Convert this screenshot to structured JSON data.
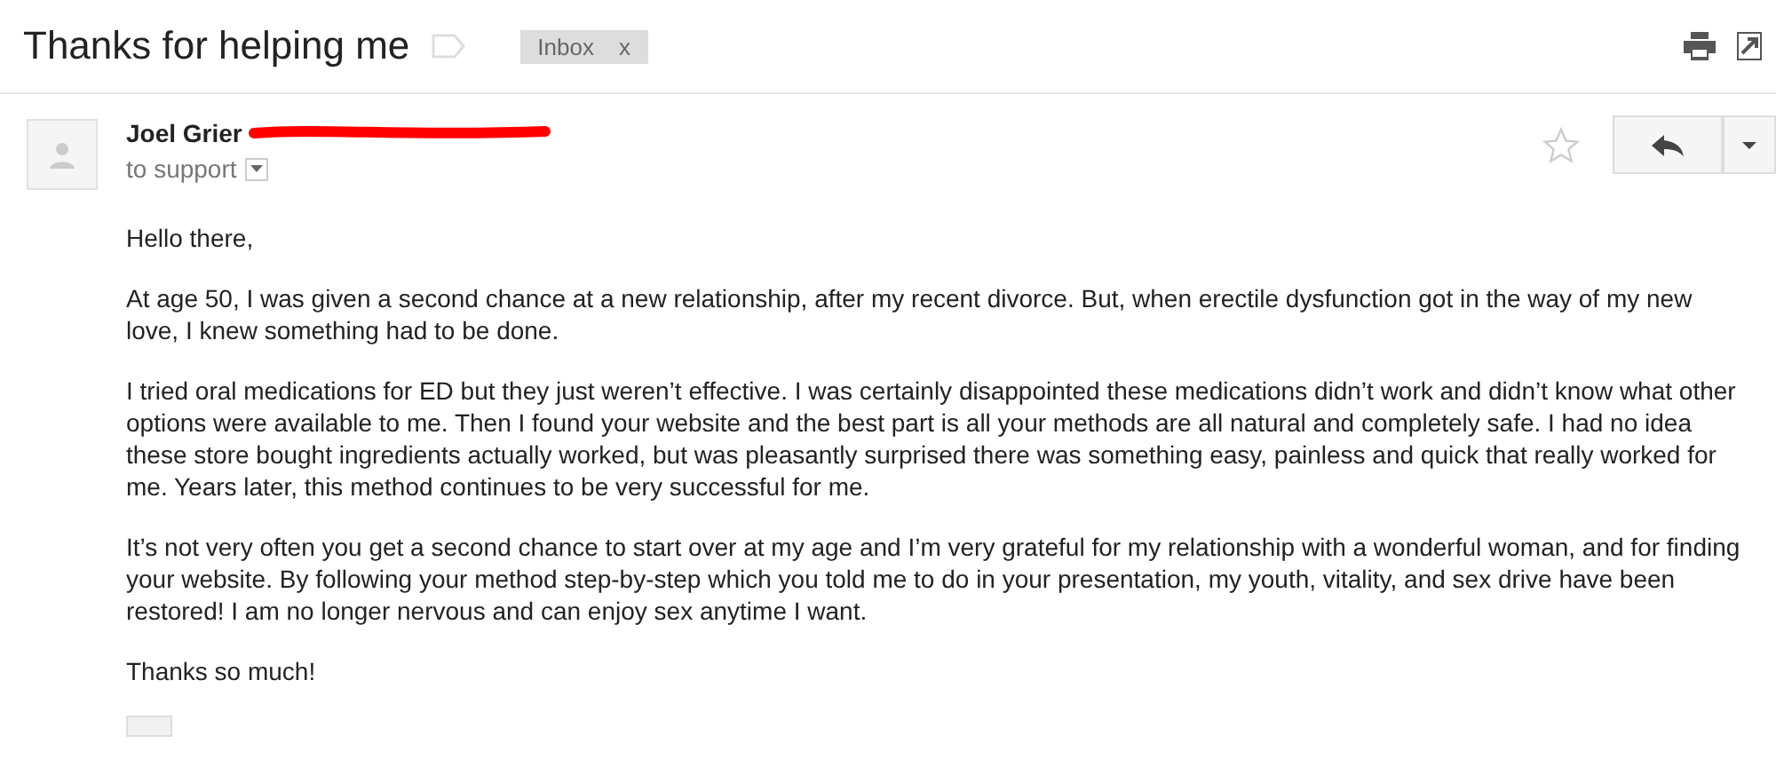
{
  "subject": "Thanks for helping me",
  "labels": [
    {
      "text": "Inbox",
      "remove": "x"
    }
  ],
  "message": {
    "sender": "Joel Grier",
    "email_redacted": true,
    "recipient": "to support",
    "starred": false,
    "body": [
      "Hello there,",
      "At age 50, I was given a second chance at a new relationship, after my recent divorce. But, when erectile dysfunction got in the way of my new love, I knew something had to be done.",
      "I tried oral medications for ED but they just weren’t effective. I was certainly disappointed these medications didn’t work and didn’t know what other options were available to me. Then I found your website and the best part is all your methods are all natural and completely safe. I had no idea these store bought ingredients actually worked, but was pleasantly surprised there was something easy, painless and quick that really worked for me. Years later, this method continues to be very successful for me.",
      "It’s not very often you get a second chance to start over at my age and I’m very grateful for my relationship with a wonderful woman, and for finding your website.  By following your method step-by-step which you told me to do in your presentation, my youth, vitality, and sex drive have been restored!  I am no longer nervous and can enjoy sex anytime I want.",
      "Thanks so much!"
    ]
  }
}
